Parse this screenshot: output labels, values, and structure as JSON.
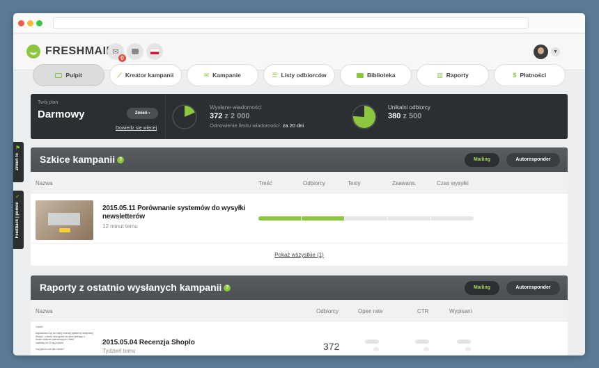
{
  "app": {
    "name": "FRESHMAIL",
    "notification_count": "0",
    "language_flag": "polish-flag"
  },
  "nav": [
    {
      "label": "Pulpit",
      "icon": "monitor-icon",
      "active": true
    },
    {
      "label": "Kreator kampanii",
      "icon": "wand-icon",
      "active": false
    },
    {
      "label": "Kampanie",
      "icon": "envelope-icon",
      "active": false
    },
    {
      "label": "Listy odbiorców",
      "icon": "list-icon",
      "active": false
    },
    {
      "label": "Biblioteka",
      "icon": "folder-icon",
      "active": false
    },
    {
      "label": "Raporty",
      "icon": "book-icon",
      "active": false
    },
    {
      "label": "Płatności",
      "icon": "dollar-icon",
      "active": false
    }
  ],
  "plan": {
    "label": "Twój plan",
    "name": "Darmowy",
    "change_label": "Zmień",
    "more_link": "Dowiedz się więcej",
    "sent": {
      "label": "Wysłane wiadomości",
      "value": "372",
      "of_text": "z 2 000",
      "renew_label": "Odnowienie limitu wiadomości:",
      "renew_value": "za 20 dni",
      "fraction": 0.186
    },
    "unique": {
      "label": "Unikalni odbiorcy",
      "value": "380",
      "of_text": "z 500",
      "fraction": 0.76
    }
  },
  "drafts": {
    "title": "Szkice kampanii",
    "tab_mailing": "Mailing",
    "tab_autoresponder": "Autoresponder",
    "columns": {
      "name": "Nazwa",
      "content": "Treść",
      "recipients": "Odbiorcy",
      "tests": "Testy",
      "advanced": "Zaawans.",
      "send_time": "Czas wysyłki"
    },
    "item": {
      "title": "2015.05.11 Porównanie systemów do wysyłki newsletterów",
      "time": "12 minut temu",
      "progress": 0.4
    },
    "show_all": "Pokaż wszystkie (1)"
  },
  "reports": {
    "title": "Raporty z ostatnio wysłanych kampanii",
    "tab_mailing": "Mailing",
    "tab_autoresponder": "Autoresponder",
    "columns": {
      "name": "Nazwa",
      "recipients": "Odbiorcy",
      "open_rate": "Open rate",
      "ctr": "CTR",
      "unsubscribed": "Wypisani"
    },
    "item": {
      "title": "2015.05.04 Recenzja Shoplo",
      "time": "Tydzień temu",
      "recipients": "372",
      "preview_lines": [
        "Cześć!",
        "",
        "Zapraszam Cię do mojej recenzji platformy sklepowej",
        "Shoplo, z której skorzystał na rzecz jednego z",
        "moich sklepów internetowych. Mam",
        "nadzieję że Ci się przyda!",
        "",
        "Czy jest to coś dla Ciebie?"
      ]
    }
  },
  "side_tabs": {
    "change_it": "Zmień to",
    "feedback": "Feedback | pomoc"
  },
  "colors": {
    "accent": "#8dc63f",
    "dark": "#2b2f31"
  }
}
